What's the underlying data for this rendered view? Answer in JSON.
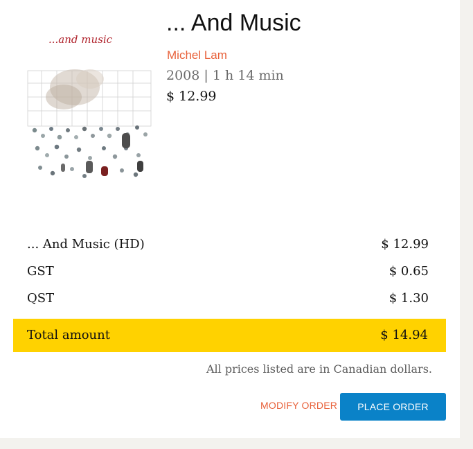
{
  "film": {
    "poster_text": "...and music",
    "title": "... And Music",
    "director": "Michel Lam",
    "meta": "2008 | 1 h 14 min",
    "price": "$ 12.99"
  },
  "order": {
    "lines": [
      {
        "label": "... And Music (HD)",
        "amount": "$ 12.99"
      },
      {
        "label": "GST",
        "amount": "$ 0.65"
      },
      {
        "label": "QST",
        "amount": "$ 1.30"
      }
    ],
    "total_label": "Total amount",
    "total_amount": "$ 14.94",
    "currency_note": "All prices listed are in Canadian dollars."
  },
  "actions": {
    "modify_label": "MODIFY ORDER",
    "place_label": "PLACE ORDER"
  },
  "colors": {
    "accent": "#e8613a",
    "total_bar": "#ffd200",
    "primary_button": "#0a82c8",
    "page_background": "#f3f2ee"
  }
}
